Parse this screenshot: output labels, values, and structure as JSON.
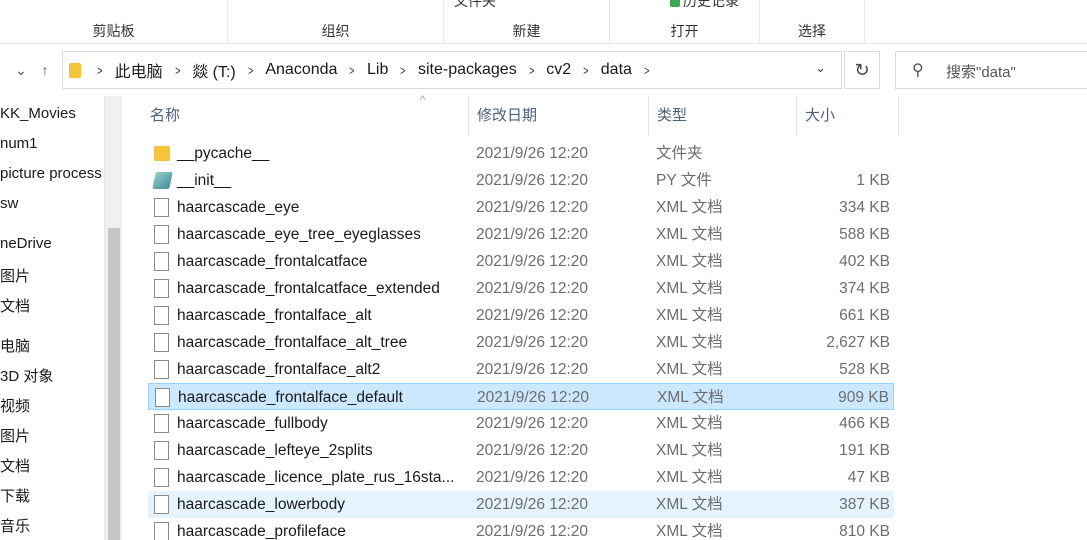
{
  "ribbon": {
    "groups": [
      "剪贴板",
      "组织",
      "新建",
      "打开",
      "选择"
    ],
    "top_labels": [
      "文件夹",
      "历史记录"
    ]
  },
  "nav": {
    "back": "←",
    "forward": "→",
    "down": "⌄",
    "up": "↑",
    "breadcrumb": [
      "此电脑",
      "燚 (T:)",
      "Anaconda",
      "Lib",
      "site-packages",
      "cv2",
      "data"
    ],
    "refresh": "↻",
    "search_placeholder": "搜索\"data\""
  },
  "sidebar": {
    "items": [
      "KK_Movies",
      "num1",
      "picture process",
      "sw",
      "neDrive",
      "图片",
      "文档",
      "电脑",
      "3D 对象",
      "视频",
      "图片",
      "文档",
      "下载",
      "音乐"
    ]
  },
  "columns": [
    "名称",
    "修改日期",
    "类型",
    "大小"
  ],
  "files": [
    {
      "name": "__pycache__",
      "date": "2021/9/26 12:20",
      "type": "文件夹",
      "size": "",
      "icon": "folder-icon"
    },
    {
      "name": "__init__",
      "date": "2021/9/26 12:20",
      "type": "PY 文件",
      "size": "1 KB",
      "icon": "python-file-icon"
    },
    {
      "name": "haarcascade_eye",
      "date": "2021/9/26 12:20",
      "type": "XML 文档",
      "size": "334 KB",
      "icon": "file-icon"
    },
    {
      "name": "haarcascade_eye_tree_eyeglasses",
      "date": "2021/9/26 12:20",
      "type": "XML 文档",
      "size": "588 KB",
      "icon": "file-icon"
    },
    {
      "name": "haarcascade_frontalcatface",
      "date": "2021/9/26 12:20",
      "type": "XML 文档",
      "size": "402 KB",
      "icon": "file-icon"
    },
    {
      "name": "haarcascade_frontalcatface_extended",
      "date": "2021/9/26 12:20",
      "type": "XML 文档",
      "size": "374 KB",
      "icon": "file-icon"
    },
    {
      "name": "haarcascade_frontalface_alt",
      "date": "2021/9/26 12:20",
      "type": "XML 文档",
      "size": "661 KB",
      "icon": "file-icon"
    },
    {
      "name": "haarcascade_frontalface_alt_tree",
      "date": "2021/9/26 12:20",
      "type": "XML 文档",
      "size": "2,627 KB",
      "icon": "file-icon"
    },
    {
      "name": "haarcascade_frontalface_alt2",
      "date": "2021/9/26 12:20",
      "type": "XML 文档",
      "size": "528 KB",
      "icon": "file-icon"
    },
    {
      "name": "haarcascade_frontalface_default",
      "date": "2021/9/26 12:20",
      "type": "XML 文档",
      "size": "909 KB",
      "icon": "file-icon",
      "state": "selected"
    },
    {
      "name": "haarcascade_fullbody",
      "date": "2021/9/26 12:20",
      "type": "XML 文档",
      "size": "466 KB",
      "icon": "file-icon"
    },
    {
      "name": "haarcascade_lefteye_2splits",
      "date": "2021/9/26 12:20",
      "type": "XML 文档",
      "size": "191 KB",
      "icon": "file-icon"
    },
    {
      "name": "haarcascade_licence_plate_rus_16sta...",
      "date": "2021/9/26 12:20",
      "type": "XML 文档",
      "size": "47 KB",
      "icon": "file-icon"
    },
    {
      "name": "haarcascade_lowerbody",
      "date": "2021/9/26 12:20",
      "type": "XML 文档",
      "size": "387 KB",
      "icon": "file-icon",
      "state": "hover"
    },
    {
      "name": "haarcascade_profileface",
      "date": "2021/9/26 12:20",
      "type": "XML 文档",
      "size": "810 KB",
      "icon": "file-icon"
    }
  ],
  "colors": {
    "selected_bg": "#cce8ff",
    "hover_bg": "#e5f3ff",
    "header_text": "#4c607a",
    "folder": "#f5c43b"
  }
}
